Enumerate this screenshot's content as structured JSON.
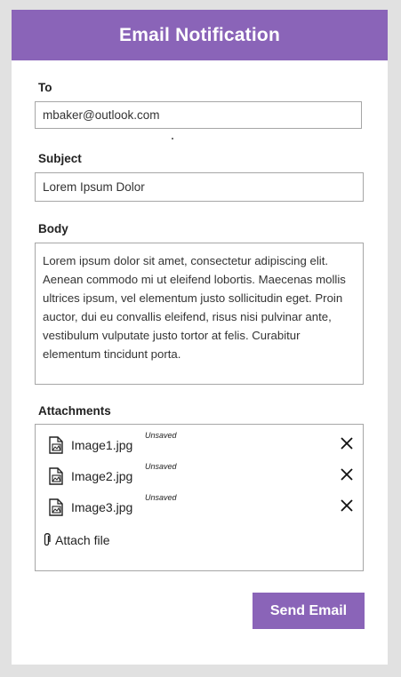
{
  "header": {
    "title": "Email Notification"
  },
  "to": {
    "label": "To",
    "value": "mbaker@outlook.com"
  },
  "subject": {
    "label": "Subject",
    "value": "Lorem Ipsum Dolor"
  },
  "body": {
    "label": "Body",
    "value": "Lorem ipsum dolor sit amet, consectetur adipiscing elit. Aenean commodo mi ut eleifend lobortis. Maecenas mollis ultrices ipsum, vel elementum justo sollicitudin eget. Proin auctor, dui eu convallis eleifend, risus nisi pulvinar ante, vestibulum vulputate justo tortor at felis. Curabitur elementum tincidunt porta."
  },
  "attachments": {
    "label": "Attachments",
    "items": [
      {
        "name": "Image1.jpg",
        "status": "Unsaved",
        "icon": "image-file-icon"
      },
      {
        "name": "Image2.jpg",
        "status": "Unsaved",
        "icon": "image-file-icon"
      },
      {
        "name": "Image3.jpg",
        "status": "Unsaved",
        "icon": "image-file-icon"
      }
    ],
    "attach_label": "Attach file",
    "attach_icon": "paperclip-icon",
    "remove_icon": "close-icon"
  },
  "actions": {
    "send_label": "Send Email"
  },
  "colors": {
    "accent": "#8a64b8",
    "background": "#e1e1e1"
  }
}
